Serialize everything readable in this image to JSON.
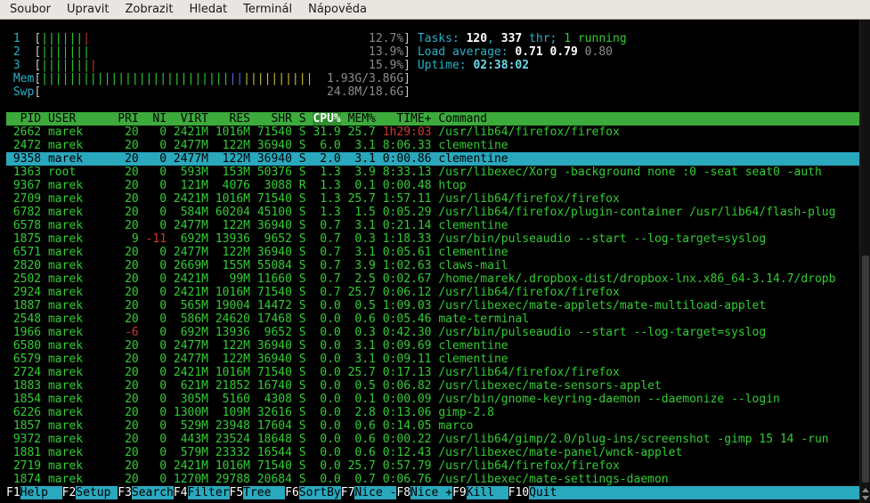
{
  "menu": {
    "items": [
      "Soubor",
      "Upravit",
      "Zobrazit",
      "Hledat",
      "Terminál",
      "Nápověda"
    ]
  },
  "htop": {
    "meters": {
      "cpus": [
        {
          "label": "1",
          "bars": [
            {
              "n": 6,
              "c": "green"
            },
            {
              "n": 1,
              "c": "red"
            }
          ],
          "text": "12.7%"
        },
        {
          "label": "2",
          "bars": [
            {
              "n": 7,
              "c": "green"
            }
          ],
          "text": "13.9%"
        },
        {
          "label": "3",
          "bars": [
            {
              "n": 7,
              "c": "green"
            },
            {
              "n": 1,
              "c": "red"
            }
          ],
          "text": "15.9%"
        }
      ],
      "mem": {
        "label": "Mem",
        "bars": [
          {
            "n": 27,
            "c": "green"
          },
          {
            "n": 2,
            "c": "blue"
          },
          {
            "n": 10,
            "c": "yellow"
          }
        ],
        "text": "1.93G/3.86G"
      },
      "swp": {
        "label": "Swp",
        "bars": [],
        "text": "24.8M/18.6G"
      }
    },
    "summary": [
      {
        "name": "tasks-summary",
        "segments": [
          {
            "t": "Tasks: ",
            "c": "cyan"
          },
          {
            "t": "120",
            "c": "bwhite"
          },
          {
            "t": ", ",
            "c": "cyan"
          },
          {
            "t": "337",
            "c": "bwhite"
          },
          {
            "t": " thr; ",
            "c": "cyan"
          },
          {
            "t": "1",
            "c": "green"
          },
          {
            "t": " running",
            "c": "green"
          }
        ]
      },
      {
        "name": "load-average-summary",
        "segments": [
          {
            "t": "Load average: ",
            "c": "cyan"
          },
          {
            "t": "0.71 ",
            "c": "bwhite"
          },
          {
            "t": "0.79 ",
            "c": "bwhite"
          },
          {
            "t": "0.80",
            "c": "dim"
          }
        ]
      },
      {
        "name": "uptime-summary",
        "segments": [
          {
            "t": "Uptime: ",
            "c": "cyan"
          },
          {
            "t": "02:38:02",
            "c": "bcyan"
          }
        ]
      }
    ],
    "table": {
      "sort_column": "CPU%",
      "columns": [
        {
          "label": "PID",
          "width": 5,
          "align": "right"
        },
        {
          "label": "USER",
          "width": 9,
          "align": "left"
        },
        {
          "label": "PRI",
          "width": 3,
          "align": "right"
        },
        {
          "label": "NI",
          "width": 3,
          "align": "right"
        },
        {
          "label": "VIRT",
          "width": 5,
          "align": "right"
        },
        {
          "label": "RES",
          "width": 5,
          "align": "right"
        },
        {
          "label": "SHR",
          "width": 5,
          "align": "right"
        },
        {
          "label": "S",
          "width": 1,
          "align": "left"
        },
        {
          "label": "CPU%",
          "width": 4,
          "align": "right"
        },
        {
          "label": "MEM%",
          "width": 4,
          "align": "right"
        },
        {
          "label": "TIME+",
          "width": 7,
          "align": "right"
        },
        {
          "label": "Command",
          "width": 0,
          "align": "left"
        }
      ],
      "rows": [
        {
          "cells": [
            "2662",
            "marek",
            "20",
            "0",
            "2421M",
            "1016M",
            "71540",
            "S",
            "31.9",
            "25.7",
            "1h29:03",
            "/usr/lib64/firefox/firefox"
          ],
          "marks": {
            "10": "red"
          }
        },
        {
          "cells": [
            "2472",
            "marek",
            "20",
            "0",
            "2477M",
            "122M",
            "36940",
            "S",
            "6.0",
            "3.1",
            "8:06.33",
            "clementine"
          ]
        },
        {
          "cells": [
            "9358",
            "marek",
            "20",
            "0",
            "2477M",
            "122M",
            "36940",
            "S",
            "2.0",
            "3.1",
            "0:00.86",
            "clementine"
          ],
          "selected": true
        },
        {
          "cells": [
            "1363",
            "root",
            "20",
            "0",
            "593M",
            "153M",
            "50376",
            "S",
            "1.3",
            "3.9",
            "8:33.13",
            "/usr/libexec/Xorg -background none :0 -seat seat0 -auth "
          ]
        },
        {
          "cells": [
            "9367",
            "marek",
            "20",
            "0",
            "121M",
            "4076",
            "3088",
            "R",
            "1.3",
            "0.1",
            "0:00.48",
            "htop"
          ]
        },
        {
          "cells": [
            "2709",
            "marek",
            "20",
            "0",
            "2421M",
            "1016M",
            "71540",
            "S",
            "1.3",
            "25.7",
            "1:57.11",
            "/usr/lib64/firefox/firefox"
          ]
        },
        {
          "cells": [
            "6782",
            "marek",
            "20",
            "0",
            "584M",
            "60204",
            "45100",
            "S",
            "1.3",
            "1.5",
            "0:05.29",
            "/usr/lib64/firefox/plugin-container /usr/lib64/flash-plug"
          ]
        },
        {
          "cells": [
            "6578",
            "marek",
            "20",
            "0",
            "2477M",
            "122M",
            "36940",
            "S",
            "0.7",
            "3.1",
            "0:21.14",
            "clementine"
          ]
        },
        {
          "cells": [
            "1875",
            "marek",
            "9",
            "-11",
            "692M",
            "13936",
            "9652",
            "S",
            "0.7",
            "0.3",
            "1:18.33",
            "/usr/bin/pulseaudio --start --log-target=syslog"
          ],
          "marks": {
            "3": "red"
          }
        },
        {
          "cells": [
            "6571",
            "marek",
            "20",
            "0",
            "2477M",
            "122M",
            "36940",
            "S",
            "0.7",
            "3.1",
            "0:05.61",
            "clementine"
          ]
        },
        {
          "cells": [
            "2820",
            "marek",
            "20",
            "0",
            "2669M",
            "155M",
            "55084",
            "S",
            "0.7",
            "3.9",
            "1:02.63",
            "claws-mail"
          ]
        },
        {
          "cells": [
            "2502",
            "marek",
            "20",
            "0",
            "2421M",
            "99M",
            "11660",
            "S",
            "0.7",
            "2.5",
            "0:02.67",
            "/home/marek/.dropbox-dist/dropbox-lnx.x86_64-3.14.7/dropb"
          ]
        },
        {
          "cells": [
            "2924",
            "marek",
            "20",
            "0",
            "2421M",
            "1016M",
            "71540",
            "S",
            "0.7",
            "25.7",
            "0:06.12",
            "/usr/lib64/firefox/firefox"
          ]
        },
        {
          "cells": [
            "1887",
            "marek",
            "20",
            "0",
            "565M",
            "19004",
            "14472",
            "S",
            "0.0",
            "0.5",
            "1:09.03",
            "/usr/libexec/mate-applets/mate-multiload-applet"
          ]
        },
        {
          "cells": [
            "2548",
            "marek",
            "20",
            "0",
            "586M",
            "24620",
            "17468",
            "S",
            "0.0",
            "0.6",
            "0:05.46",
            "mate-terminal"
          ]
        },
        {
          "cells": [
            "1966",
            "marek",
            "-6",
            "0",
            "692M",
            "13936",
            "9652",
            "S",
            "0.0",
            "0.3",
            "0:42.30",
            "/usr/bin/pulseaudio --start --log-target=syslog"
          ],
          "marks": {
            "2": "red"
          }
        },
        {
          "cells": [
            "6580",
            "marek",
            "20",
            "0",
            "2477M",
            "122M",
            "36940",
            "S",
            "0.0",
            "3.1",
            "0:09.69",
            "clementine"
          ]
        },
        {
          "cells": [
            "6579",
            "marek",
            "20",
            "0",
            "2477M",
            "122M",
            "36940",
            "S",
            "0.0",
            "3.1",
            "0:09.11",
            "clementine"
          ]
        },
        {
          "cells": [
            "2724",
            "marek",
            "20",
            "0",
            "2421M",
            "1016M",
            "71540",
            "S",
            "0.0",
            "25.7",
            "0:17.13",
            "/usr/lib64/firefox/firefox"
          ]
        },
        {
          "cells": [
            "1883",
            "marek",
            "20",
            "0",
            "621M",
            "21852",
            "16740",
            "S",
            "0.0",
            "0.5",
            "0:06.82",
            "/usr/libexec/mate-sensors-applet"
          ]
        },
        {
          "cells": [
            "1854",
            "marek",
            "20",
            "0",
            "305M",
            "5160",
            "4308",
            "S",
            "0.0",
            "0.1",
            "0:00.09",
            "/usr/bin/gnome-keyring-daemon --daemonize --login"
          ]
        },
        {
          "cells": [
            "6226",
            "marek",
            "20",
            "0",
            "1300M",
            "109M",
            "32616",
            "S",
            "0.0",
            "2.8",
            "0:13.06",
            "gimp-2.8"
          ]
        },
        {
          "cells": [
            "1857",
            "marek",
            "20",
            "0",
            "529M",
            "23948",
            "17604",
            "S",
            "0.0",
            "0.6",
            "0:14.05",
            "marco"
          ]
        },
        {
          "cells": [
            "9372",
            "marek",
            "20",
            "0",
            "443M",
            "23524",
            "18648",
            "S",
            "0.0",
            "0.6",
            "0:00.22",
            "/usr/lib64/gimp/2.0/plug-ins/screenshot -gimp 15 14 -run"
          ]
        },
        {
          "cells": [
            "1881",
            "marek",
            "20",
            "0",
            "579M",
            "23332",
            "16544",
            "S",
            "0.0",
            "0.6",
            "0:12.43",
            "/usr/libexec/mate-panel/wnck-applet"
          ]
        },
        {
          "cells": [
            "2719",
            "marek",
            "20",
            "0",
            "2421M",
            "1016M",
            "71540",
            "S",
            "0.0",
            "25.7",
            "0:57.79",
            "/usr/lib64/firefox/firefox"
          ]
        },
        {
          "cells": [
            "1874",
            "marek",
            "20",
            "0",
            "1270M",
            "29788",
            "20684",
            "S",
            "0.0",
            "0.7",
            "0:06.76",
            "/usr/libexec/mate-settings-daemon"
          ]
        }
      ]
    },
    "fnbar": {
      "items": [
        {
          "key": "F1",
          "label": "Help  "
        },
        {
          "key": "F2",
          "label": "Setup "
        },
        {
          "key": "F3",
          "label": "Search"
        },
        {
          "key": "F4",
          "label": "Filter"
        },
        {
          "key": "F5",
          "label": "Tree  "
        },
        {
          "key": "F6",
          "label": "SortBy"
        },
        {
          "key": "F7",
          "label": "Nice -"
        },
        {
          "key": "F8",
          "label": "Nice +"
        },
        {
          "key": "F9",
          "label": "Kill  "
        },
        {
          "key": "F10",
          "label": "Quit  "
        }
      ]
    }
  },
  "colors": {
    "background": "#000000",
    "process_text": "#32cd32",
    "header_bg": "#3cab3c",
    "selection_bg": "#2aa8bd",
    "accent_cyan": "#28b1c7",
    "alert_red": "#cc3b2a",
    "menu_bg": "#e9e6e2"
  }
}
